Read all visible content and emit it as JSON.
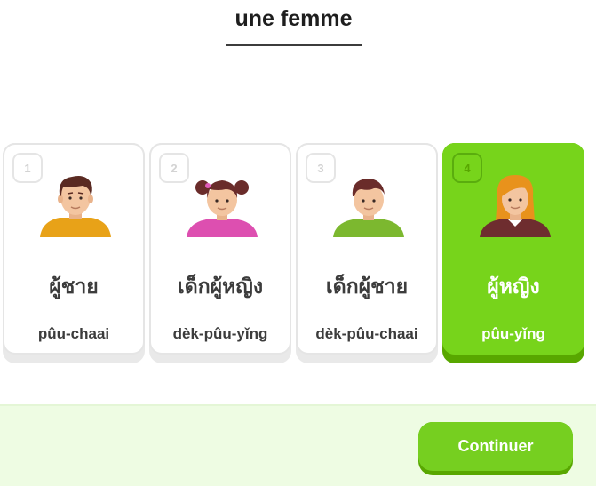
{
  "prompt": {
    "text": "une femme"
  },
  "choices": [
    {
      "number": "1",
      "thai": "ผู้ชาย",
      "romanization": "pûu-chaai",
      "avatar": "man-avatar-icon"
    },
    {
      "number": "2",
      "thai": "เด็กผู้หญิง",
      "romanization": "dèk-pûu-yǐng",
      "avatar": "girl-avatar-icon"
    },
    {
      "number": "3",
      "thai": "เด็กผู้ชาย",
      "romanization": "dèk-pûu-chaai",
      "avatar": "boy-avatar-icon"
    },
    {
      "number": "4",
      "thai": "ผู้หญิง",
      "romanization": "pûu-yǐng",
      "avatar": "woman-avatar-icon",
      "selected": true
    }
  ],
  "footer": {
    "continue_label": "Continuer"
  },
  "colors": {
    "selected_green": "#77d41b",
    "button_green": "#76cf20",
    "footer_bg": "#eefce3"
  }
}
